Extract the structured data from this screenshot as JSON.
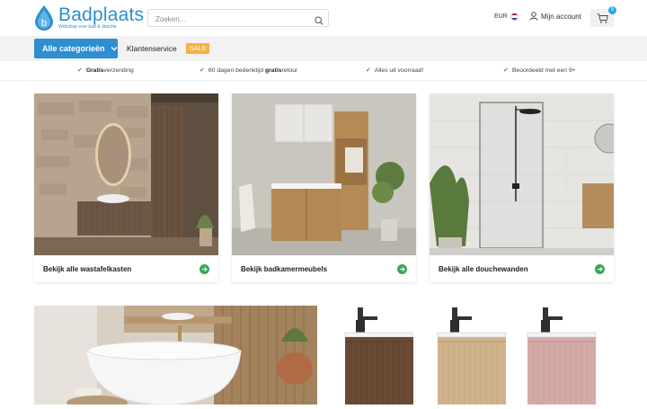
{
  "header": {
    "logo_name": "Badplaats",
    "logo_letter": "b",
    "logo_tagline": "Webshop voor bad & douche",
    "search_placeholder": "Zoeken...",
    "currency": "EUR",
    "account_label": "Mijn account",
    "cart_count": "0"
  },
  "nav": {
    "all_categories": "Alle categorieën",
    "customer_service": "Klantenservice",
    "sale": "SALE"
  },
  "usp": [
    {
      "bold": "Gratis",
      "text": " verzending"
    },
    {
      "pre": "60 dagen bedenktijd ",
      "bold": "gratis",
      "text": " retour"
    },
    {
      "text": "Alles uit voorraad!"
    },
    {
      "text": "Beoordeeld met een 9+"
    }
  ],
  "categories": [
    {
      "label": "Bekijk alle wastafelkasten"
    },
    {
      "label": "Bekijk badkamermeubels"
    },
    {
      "label": "Bekijk alle douchewanden"
    }
  ],
  "colors": {
    "brand_blue": "#2f8ed2",
    "green": "#3aa757",
    "sale_orange": "#f5b13f"
  }
}
